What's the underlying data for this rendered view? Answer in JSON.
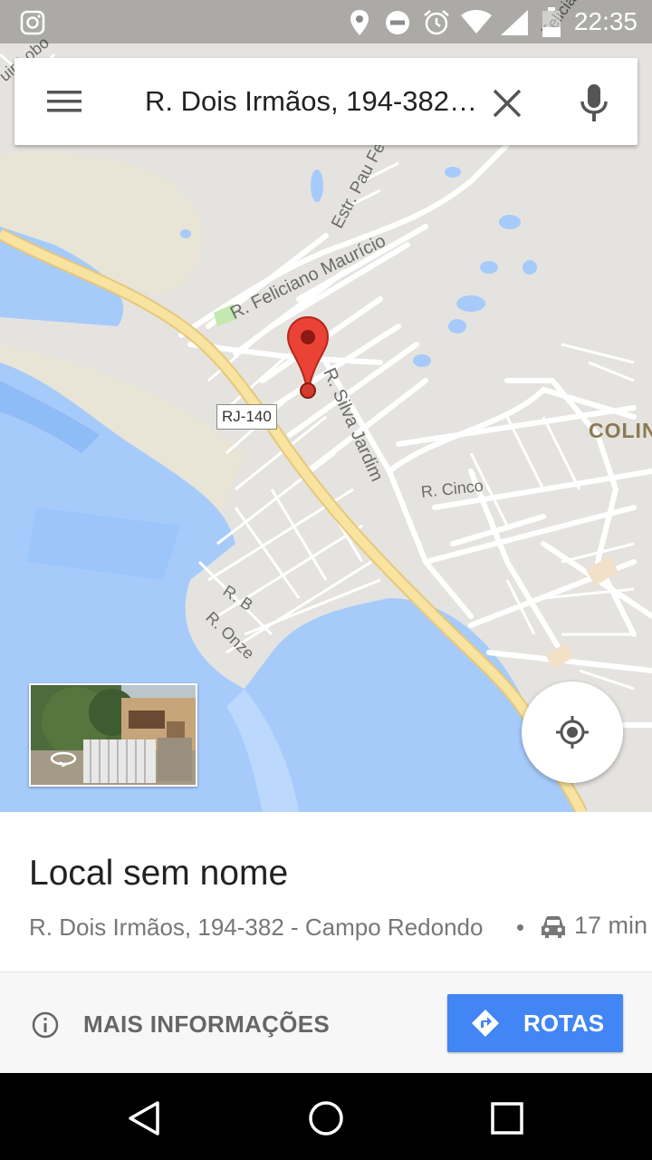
{
  "status_bar": {
    "time": "22:35",
    "icons": [
      "instagram-icon",
      "location-icon",
      "do-not-disturb-icon",
      "alarm-icon",
      "wifi-icon",
      "signal-icon",
      "battery-icon"
    ]
  },
  "search": {
    "query": "R. Dois Irmãos, 194-382 - Campo Redondo",
    "menu_icon": "menu-icon",
    "clear_icon": "close-icon",
    "mic_icon": "mic-icon"
  },
  "map": {
    "labels": {
      "felicianoMauricio": "R. Feliciano Maurício",
      "pauFerro": "Estr. Pau Fer",
      "silvaJardim": "R. Silva Jardim",
      "cinco": "R. Cinco",
      "rb": "R. B",
      "onze": "R. Onze",
      "colin": "COLIN",
      "felicianoTop": "Feliciano",
      "topLeft": "uir Lobo"
    },
    "highway_shield": "RJ-140",
    "colors": {
      "land": "#e5e3df",
      "water": "#a6cbfb",
      "highway": "#f5dd8e",
      "road": "#ffffff",
      "pin": "#ea4335"
    }
  },
  "place": {
    "title": "Local sem nome",
    "address": "R. Dois Irmãos, 194-382 - Campo Redondo",
    "separator": "•",
    "drive_time": "17 min"
  },
  "actions": {
    "more_info": "MAIS INFORMAÇÕES",
    "routes": "ROTAS",
    "routes_color": "#4285f4"
  },
  "nav": {
    "icons": [
      "back-icon",
      "home-icon",
      "recents-icon"
    ]
  }
}
